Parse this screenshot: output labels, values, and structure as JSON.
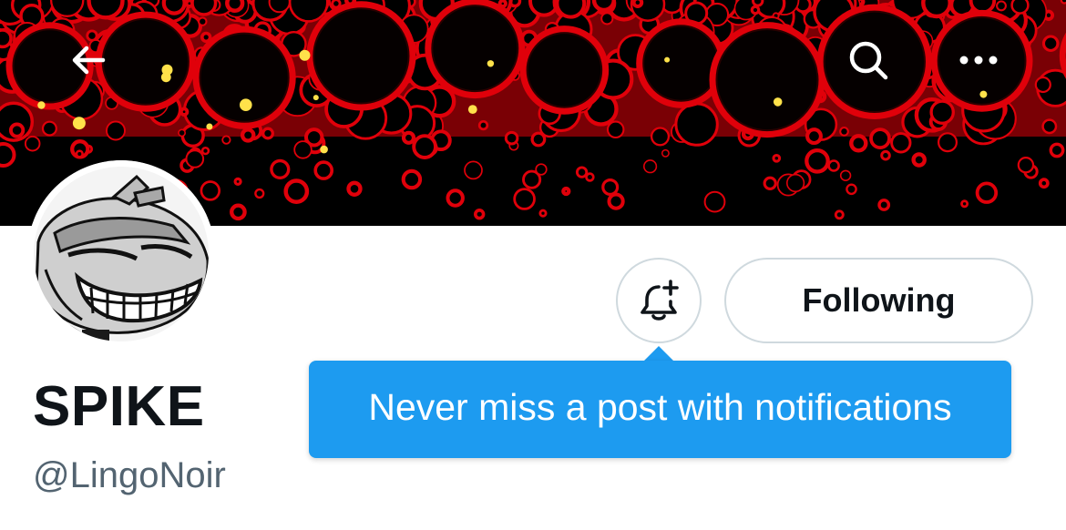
{
  "profile": {
    "display_name": "SPIKE",
    "handle": "@LingoNoir"
  },
  "actions": {
    "following_label": "Following"
  },
  "tooltip": {
    "text": "Never miss a post with notifications"
  },
  "icons": {
    "back": "arrow-left-icon",
    "search": "search-icon",
    "more": "more-horizontal-icon",
    "notify": "bell-plus-icon"
  },
  "colors": {
    "accent": "#1d9bf0",
    "text_primary": "#0f1419",
    "text_secondary": "#536471",
    "button_border": "#cfd9de",
    "banner_red": "#e0000a"
  }
}
